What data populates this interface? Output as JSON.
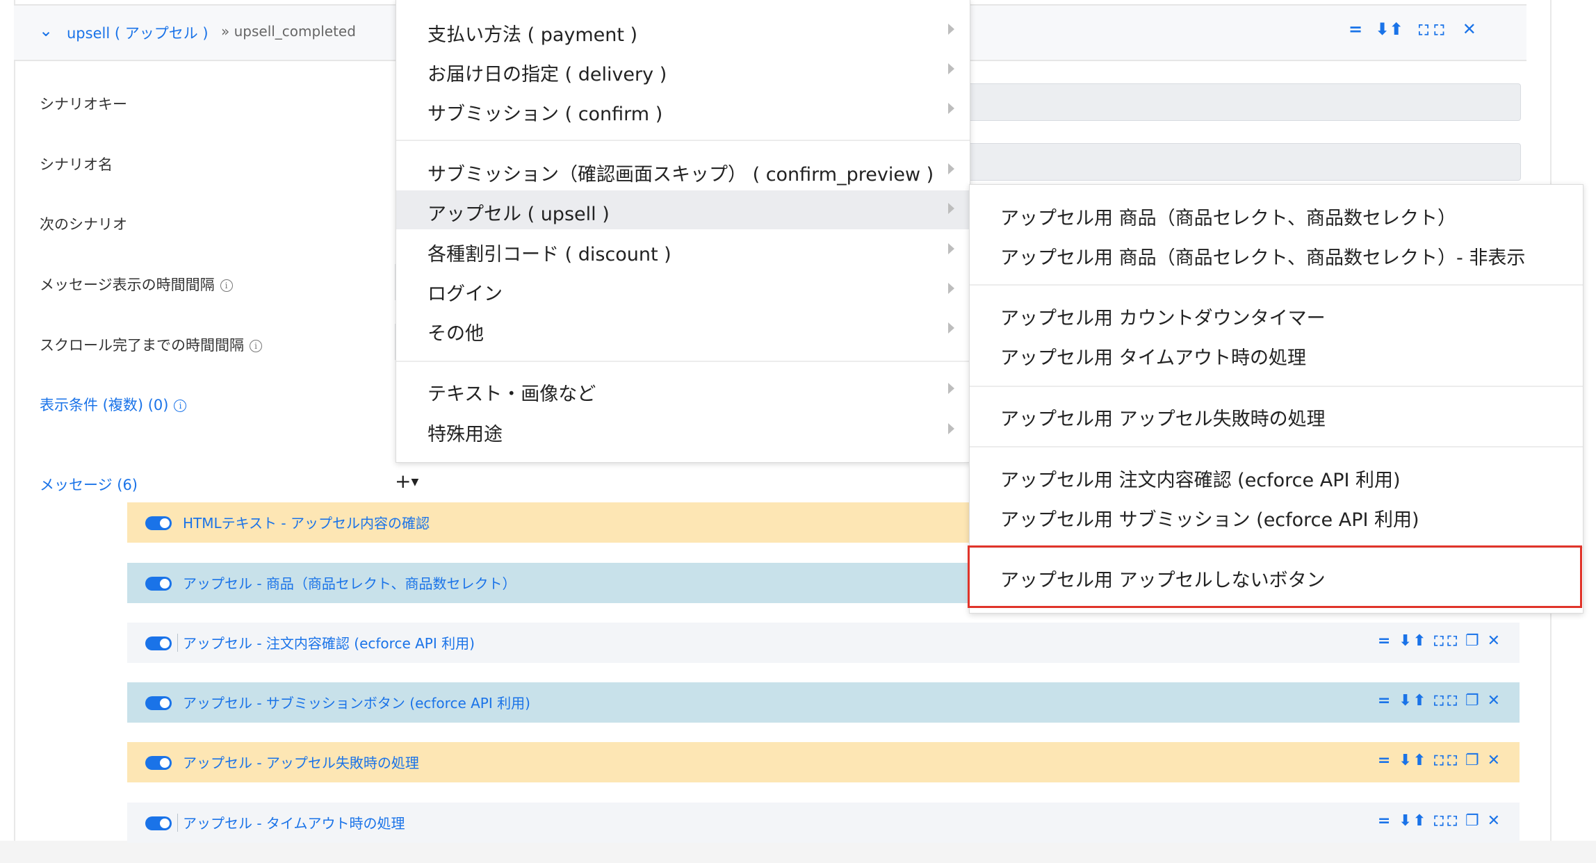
{
  "header": {
    "scenario_name": "upsell ( アップセル )",
    "scenario_path": "» upsell_completed",
    "tools": [
      "=",
      "⬇",
      "⬆",
      "⛶",
      "⛶",
      "✕"
    ]
  },
  "form": {
    "labels": {
      "scenario_key": "シナリオキー",
      "scenario_name": "シナリオ名",
      "next_scenario": "次のシナリオ",
      "message_interval": "メッセージ表示の時間間隔",
      "scroll_interval": "スクロール完了までの時間間隔",
      "display_conditions": "表示条件 (複数) (0)",
      "messages": "メッセージ (6)"
    },
    "add_button": "+"
  },
  "messages": [
    {
      "label": "HTMLテキスト - アップセル内容の確認",
      "color": "#fde6b4",
      "enabled": true
    },
    {
      "label": "アップセル - 商品（商品セレクト、商品数セレクト）",
      "color": "#c8e1ea",
      "enabled": true
    },
    {
      "label": "アップセル - 注文内容確認 (ecforce API 利用)",
      "color": "#f3f5f8",
      "enabled": true
    },
    {
      "label": "アップセル - サブミッションボタン (ecforce API 利用)",
      "color": "#c8e1ea",
      "enabled": true
    },
    {
      "label": "アップセル - アップセル失敗時の処理",
      "color": "#fde6b4",
      "enabled": true
    },
    {
      "label": "アップセル - タイムアウト時の処理",
      "color": "#f3f5f8",
      "enabled": true
    }
  ],
  "main_menu": {
    "items": [
      {
        "label": "支払い方法 ( payment )"
      },
      {
        "label": "お届け日の指定 ( delivery )"
      },
      {
        "label": "サブミッション ( confirm )"
      },
      {
        "label": "サブミッション（確認画面スキップ） ( confirm_preview )"
      },
      {
        "label": "アップセル ( upsell )",
        "active": true
      },
      {
        "label": "各種割引コード ( discount )"
      },
      {
        "label": "ログイン"
      },
      {
        "label": "その他"
      },
      {
        "label": "テキスト・画像など"
      },
      {
        "label": "特殊用途"
      }
    ]
  },
  "sub_menu": {
    "items": [
      {
        "label": "アップセル用 商品（商品セレクト、商品数セレクト）"
      },
      {
        "label": "アップセル用 商品（商品セレクト、商品数セレクト）- 非表示"
      },
      {
        "label": "アップセル用 カウントダウンタイマー"
      },
      {
        "label": "アップセル用 タイムアウト時の処理"
      },
      {
        "label": "アップセル用 アップセル失敗時の処理"
      },
      {
        "label": "アップセル用 注文内容確認 (ecforce API 利用)"
      },
      {
        "label": "アップセル用 サブミッション (ecforce API 利用)"
      },
      {
        "label": "アップセル用 アップセルしないボタン",
        "highlighted": true
      }
    ]
  },
  "colors": {
    "accent": "#1a73e8",
    "highlight_border": "#e0342a"
  },
  "icons": {
    "collapse": "chevron-down-icon",
    "info": "info-icon",
    "drag": "drag-handle-icon",
    "move_down": "arrow-down-icon",
    "move_up": "arrow-up-icon",
    "compress": "compress-icon",
    "expand": "expand-icon",
    "copy": "copy-icon",
    "close": "close-icon",
    "submenu": "caret-right-icon"
  }
}
